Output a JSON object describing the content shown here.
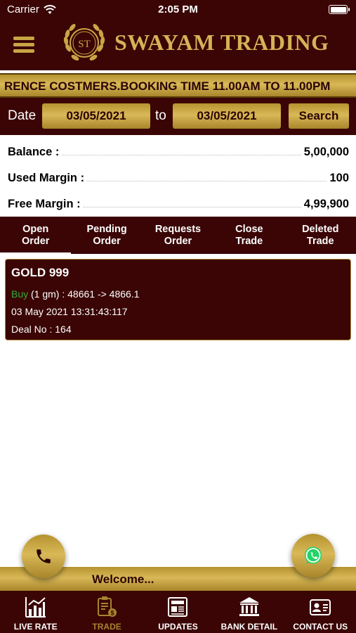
{
  "status_bar": {
    "carrier": "Carrier",
    "time": "2:05 PM"
  },
  "header": {
    "title": "SWAYAM TRADING",
    "logo_monogram": "ST"
  },
  "marquee": {
    "text": "RENCE COSTMERS.BOOKING TIME 11.00AM TO 11.00PM"
  },
  "date_filter": {
    "date_label": "Date",
    "from_value": "03/05/2021",
    "to_label": "to",
    "to_value": "03/05/2021",
    "search_label": "Search"
  },
  "summary": {
    "balance_label": "Balance :",
    "balance_value": "5,00,000",
    "used_margin_label": "Used Margin :",
    "used_margin_value": "100",
    "free_margin_label": "Free Margin :",
    "free_margin_value": "4,99,900"
  },
  "tabs": [
    {
      "line1": "Open",
      "line2": "Order",
      "active": true
    },
    {
      "line1": "Pending",
      "line2": "Order",
      "active": false
    },
    {
      "line1": "Requests",
      "line2": "Order",
      "active": false
    },
    {
      "line1": "Close",
      "line2": "Trade",
      "active": false
    },
    {
      "line1": "Deleted",
      "line2": "Trade",
      "active": false
    }
  ],
  "order": {
    "title": "GOLD 999",
    "side": "Buy",
    "detail": " (1 gm) : 48661 -> 4866.1",
    "datetime": "03 May 2021 13:31:43:117",
    "deal": "Deal No : 164"
  },
  "welcome": {
    "text": "Welcome..."
  },
  "bottom_nav": [
    {
      "label": "LIVE RATE",
      "icon": "chart-icon",
      "active": false
    },
    {
      "label": "TRADE",
      "icon": "trade-icon",
      "active": true
    },
    {
      "label": "UPDATES",
      "icon": "newspaper-icon",
      "active": false
    },
    {
      "label": "BANK DETAIL",
      "icon": "bank-icon",
      "active": false
    },
    {
      "label": "CONTACT US",
      "icon": "contact-card-icon",
      "active": false
    }
  ],
  "colors": {
    "maroon": "#3b0505",
    "gold": "#c9a544",
    "buy_green": "#2fae3a"
  }
}
